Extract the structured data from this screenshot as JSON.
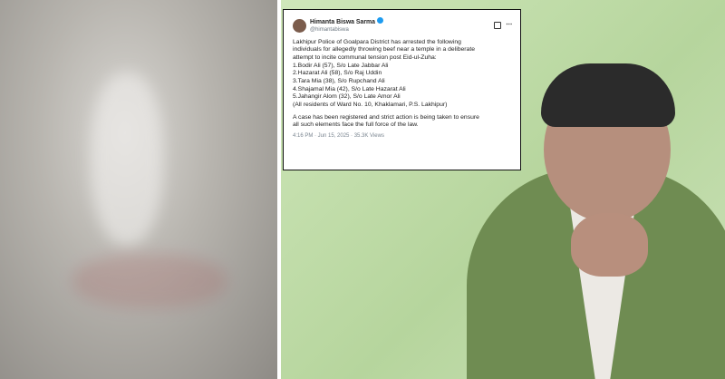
{
  "tweet": {
    "name": "Himanta Biswa Sarma",
    "handle": "@himantabiswa",
    "lines": [
      "Lakhipur Police of Goalpara District has arrested the following",
      "individuals for allegedly throwing beef near a temple in a deliberate",
      "attempt to incite communal tension post Eid-ul-Zuha:",
      "1.Bodir Ali (57), S/o Late Jabbar Ali",
      "2.Hazarat Ali (58), S/o Raj Uddin",
      "3.Tara Mia (38), S/o Rupchand Ali",
      "4.Shajamal Mia (42), S/o Late Hazarat Ali",
      "5.Jahangir Alom (32), S/o Late Amor Ali",
      "(All residents of Ward No. 10, Khaklamari, P.S. Lakhipur)",
      "",
      "A case has been registered and strict action is being taken to ensure",
      "all such elements face the full force of the law."
    ],
    "meta": "4:16 PM · Jun 15, 2025 · 35.3K Views"
  }
}
